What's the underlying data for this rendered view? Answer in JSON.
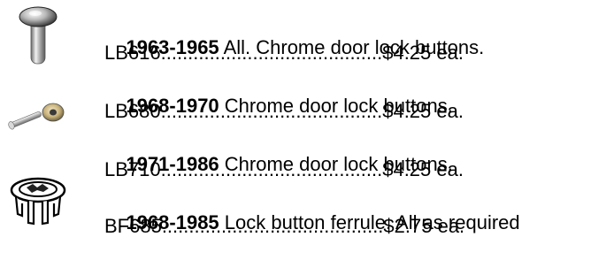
{
  "items": [
    {
      "years": "1963-1965",
      "description": " All. Chrome door lock buttons.",
      "part_line": "LB616.........................................$4.25 ea.",
      "icon": "chrome-knob-lock-button-icon"
    },
    {
      "years": "1968-1970",
      "description": " Chrome door lock buttons.",
      "part_line": "LB680.........................................$4.25 ea.",
      "icon": "chrome-pin-lock-button-icon"
    },
    {
      "years": "1971-1986",
      "description": " Chrome door lock buttons.",
      "part_line": "LB710.........................................$4.25 ea.",
      "icon": null
    },
    {
      "years": "1968-1985",
      "description": " Lock button ferrule. All as required",
      "part_line": "BF685.........................................$2.75 ea.",
      "icon": "ferrule-clip-icon"
    }
  ]
}
